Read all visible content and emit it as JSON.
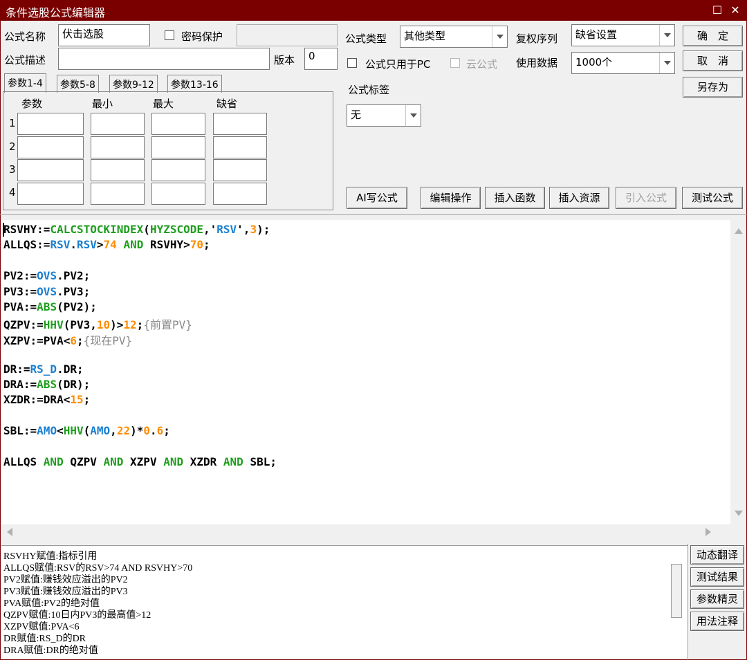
{
  "window": {
    "title": "条件选股公式编辑器",
    "maximize_glyph": "☐",
    "close_glyph": "✕"
  },
  "form": {
    "name_label": "公式名称",
    "name_value": "伏击选股",
    "password_label": "密码保护",
    "password_value": "",
    "desc_label": "公式描述",
    "desc_value": "",
    "version_label": "版本",
    "version_value": "0",
    "type_label": "公式类型",
    "type_value": "其他类型",
    "rights_label": "复权序列",
    "rights_value": "缺省设置",
    "pc_only_label": "公式只用于PC",
    "cloud_label": "云公式",
    "data_label": "使用数据",
    "data_value": "1000个",
    "tag_label": "公式标签",
    "tag_value": "无"
  },
  "buttons": {
    "ok": "确　定",
    "cancel": "取　消",
    "save_as": "另存为",
    "ai_write": "AI写公式",
    "edit_ops": "编辑操作",
    "insert_func": "插入函数",
    "insert_res": "插入资源",
    "import": "引入公式",
    "test": "测试公式"
  },
  "params": {
    "tabs": [
      "参数1-4",
      "参数5-8",
      "参数9-12",
      "参数13-16"
    ],
    "headers": [
      "参数",
      "最小",
      "最大",
      "缺省"
    ],
    "rows": [
      "1",
      "2",
      "3",
      "4"
    ]
  },
  "code_lines": [
    [
      [
        "RSVHY:=",
        ""
      ],
      [
        "CALCSTOCKINDEX",
        "fn"
      ],
      [
        "(",
        ""
      ],
      [
        "HYZSCODE",
        "fn"
      ],
      [
        ",'",
        ""
      ],
      [
        "RSV",
        "var"
      ],
      [
        "',",
        ""
      ],
      [
        "3",
        "num"
      ],
      [
        ");",
        ""
      ]
    ],
    [
      [
        "ALLQS:=",
        ""
      ],
      [
        "RSV",
        "var"
      ],
      [
        ".",
        ""
      ],
      [
        "RSV",
        "var"
      ],
      [
        ">",
        ""
      ],
      [
        "74",
        "num"
      ],
      [
        " ",
        ""
      ],
      [
        "AND",
        "fn"
      ],
      [
        " RSVHY>",
        ""
      ],
      [
        "70",
        "num"
      ],
      [
        ";",
        ""
      ]
    ],
    [],
    [
      [
        "PV2:=",
        ""
      ],
      [
        "OVS",
        "var"
      ],
      [
        ".PV2;",
        ""
      ]
    ],
    [
      [
        "PV3:=",
        ""
      ],
      [
        "OVS",
        "var"
      ],
      [
        ".PV3;",
        ""
      ]
    ],
    [
      [
        "PVA:=",
        ""
      ],
      [
        "ABS",
        "fn"
      ],
      [
        "(PV2);",
        ""
      ]
    ],
    [
      [
        "QZPV:=",
        ""
      ],
      [
        "HHV",
        "fn"
      ],
      [
        "(PV3,",
        ""
      ],
      [
        "10",
        "num"
      ],
      [
        ")>",
        ""
      ],
      [
        "12",
        "num"
      ],
      [
        ";",
        ""
      ],
      [
        "{前置PV}",
        "cm"
      ]
    ],
    [
      [
        "XZPV:=PVA<",
        ""
      ],
      [
        "6",
        "num"
      ],
      [
        ";",
        ""
      ],
      [
        "{现在PV}",
        "cm"
      ]
    ],
    [],
    [
      [
        "DR:=",
        ""
      ],
      [
        "RS_D",
        "var"
      ],
      [
        ".DR;",
        ""
      ]
    ],
    [
      [
        "DRA:=",
        ""
      ],
      [
        "ABS",
        "fn"
      ],
      [
        "(DR);",
        ""
      ]
    ],
    [
      [
        "XZDR:=DRA<",
        ""
      ],
      [
        "15",
        "num"
      ],
      [
        ";",
        ""
      ]
    ],
    [],
    [
      [
        "SBL:=",
        ""
      ],
      [
        "AMO",
        "var"
      ],
      [
        "<",
        ""
      ],
      [
        "HHV",
        "fn"
      ],
      [
        "(",
        ""
      ],
      [
        "AMO",
        "var"
      ],
      [
        ",",
        ""
      ],
      [
        "22",
        "num"
      ],
      [
        ")*",
        ""
      ],
      [
        "0",
        "num"
      ],
      [
        ".",
        ""
      ],
      [
        "6",
        "num"
      ],
      [
        ";",
        ""
      ]
    ],
    [],
    [
      [
        "ALLQS ",
        ""
      ],
      [
        "AND",
        "fn"
      ],
      [
        " QZPV ",
        ""
      ],
      [
        "AND",
        "fn"
      ],
      [
        " XZPV ",
        ""
      ],
      [
        "AND",
        "fn"
      ],
      [
        " XZDR ",
        ""
      ],
      [
        "AND",
        "fn"
      ],
      [
        " SBL;",
        ""
      ]
    ]
  ],
  "output_lines": [
    "RSVHY赋值:指标引用",
    "ALLQS赋值:RSV的RSV>74 AND RSVHY>70",
    "PV2赋值:赚钱效应溢出的PV2",
    "PV3赋值:赚钱效应溢出的PV3",
    "PVA赋值:PV2的绝对值",
    "QZPV赋值:10日内PV3的最高值>12",
    "XZPV赋值:PVA<6",
    "DR赋值:RS_D的DR",
    "DRA赋值:DR的绝对值"
  ],
  "side_buttons": [
    "动态翻译",
    "测试结果",
    "参数精灵",
    "用法注释"
  ],
  "colors": {
    "title_bg": "#7a0000",
    "fn": "#1e9e1e",
    "var": "#1a7fcf",
    "num": "#ff8c00",
    "comment": "#888888"
  }
}
